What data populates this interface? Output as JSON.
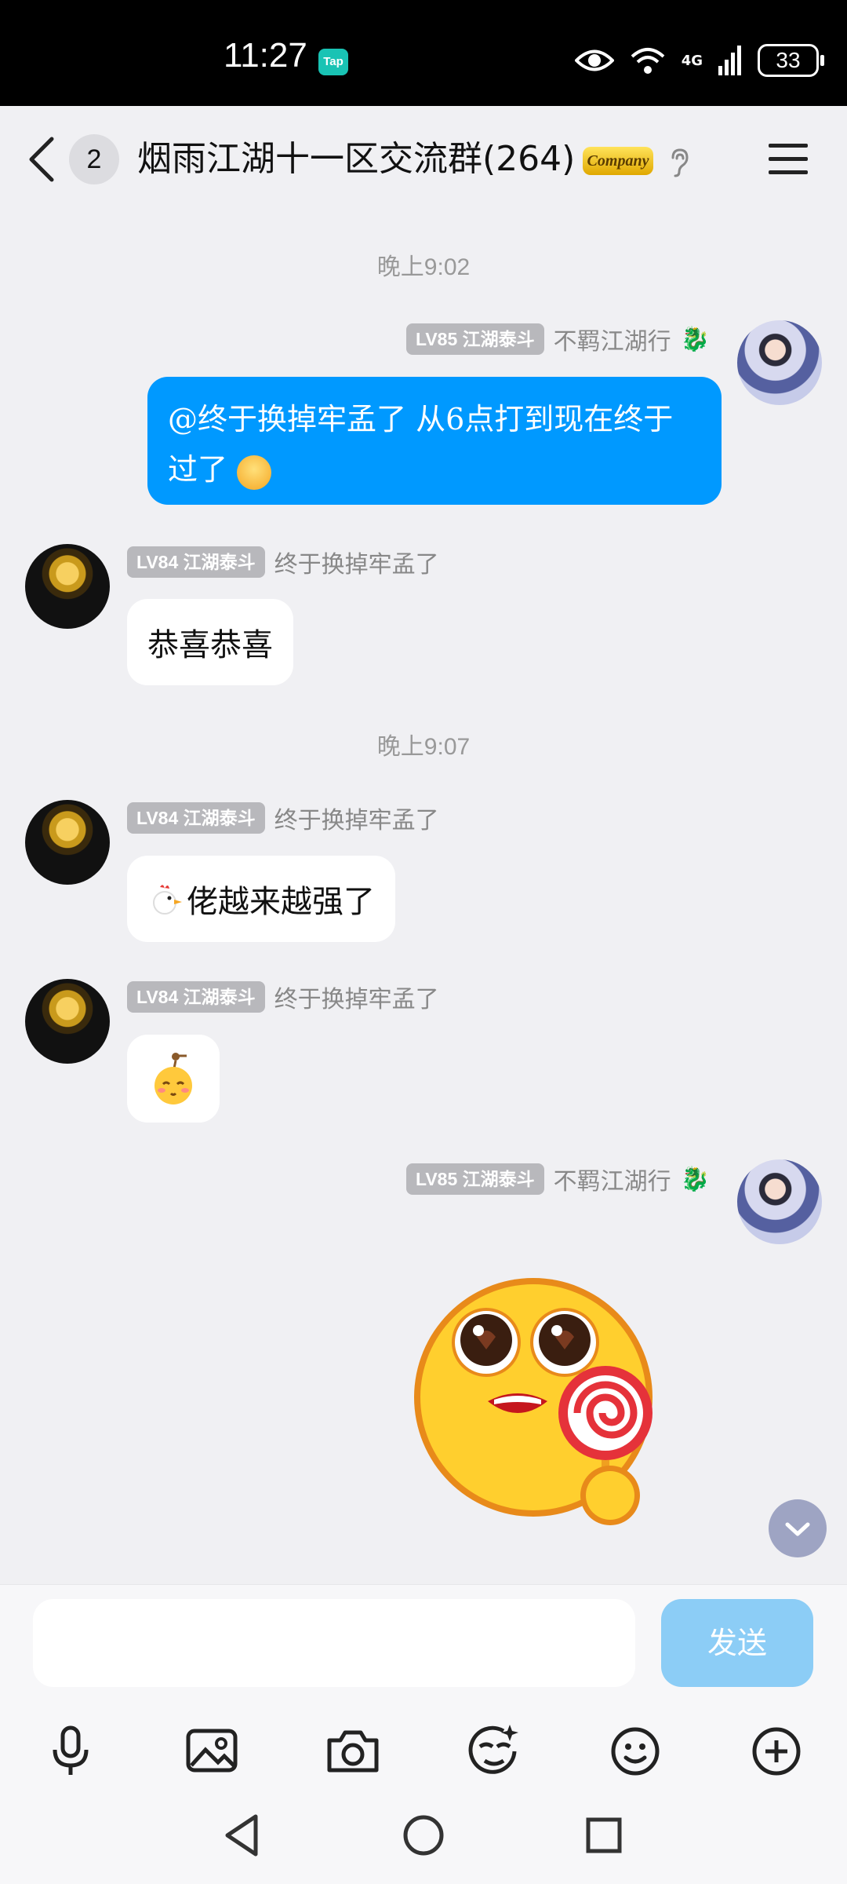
{
  "status_bar": {
    "time": "11:27",
    "tap_icon": "Tap",
    "network": "4G",
    "battery": "33"
  },
  "header": {
    "unread_count": "2",
    "title": "烟雨江湖十一区交流群(264)",
    "deco_badge": "Company"
  },
  "messages": [
    {
      "type": "time",
      "text": "晚上9:02"
    },
    {
      "type": "outgoing",
      "level": "LV85 江湖泰斗",
      "sender": "不羁江湖行",
      "text": "@终于换掉牢孟了 从6点打到现在终于过了"
    },
    {
      "type": "incoming",
      "level": "LV84 江湖泰斗",
      "sender": "终于换掉牢孟了",
      "text": "恭喜恭喜"
    },
    {
      "type": "time",
      "text": "晚上9:07"
    },
    {
      "type": "incoming",
      "level": "LV84 江湖泰斗",
      "sender": "终于换掉牢孟了",
      "text": "佬越来越强了"
    },
    {
      "type": "incoming",
      "level": "LV84 江湖泰斗",
      "sender": "终于换掉牢孟了",
      "text": ""
    },
    {
      "type": "outgoing",
      "level": "LV85 江湖泰斗",
      "sender": "不羁江湖行",
      "text": ""
    }
  ],
  "input": {
    "placeholder": "",
    "send_label": "发送"
  },
  "toolbar_icons": [
    "microphone-icon",
    "image-icon",
    "camera-icon",
    "sticker-icon",
    "smiley-icon",
    "plus-icon"
  ],
  "colors": {
    "my_bubble": "#0099ff",
    "send_button": "#8ccdf6",
    "background": "#f0f0f3"
  }
}
